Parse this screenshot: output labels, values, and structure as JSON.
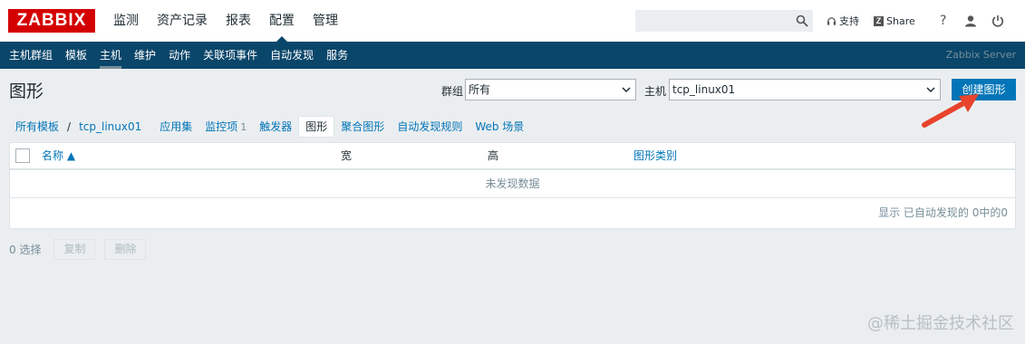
{
  "app": {
    "logo": "ZABBIX",
    "top_menu": [
      "监测",
      "资产记录",
      "报表",
      "配置",
      "管理"
    ],
    "support_label": "支持",
    "share_label": "Share",
    "help_label": "?"
  },
  "subnav": {
    "items": [
      "主机群组",
      "模板",
      "主机",
      "维护",
      "动作",
      "关联项事件",
      "自动发现",
      "服务"
    ],
    "server_name": "Zabbix Server"
  },
  "header": {
    "title": "图形",
    "group_label": "群组",
    "group_value": "所有",
    "host_label": "主机",
    "host_value": "tcp_linux01",
    "create_button": "创建图形"
  },
  "breadcrumb": {
    "all_templates": "所有模板",
    "separator": "/",
    "host": "tcp_linux01",
    "tabs": [
      {
        "label": "应用集",
        "count": ""
      },
      {
        "label": "监控项",
        "count": "1"
      },
      {
        "label": "触发器",
        "count": ""
      },
      {
        "label": "图形",
        "count": ""
      },
      {
        "label": "聚合图形",
        "count": ""
      },
      {
        "label": "自动发现规则",
        "count": ""
      },
      {
        "label": "Web 场景",
        "count": ""
      }
    ]
  },
  "table": {
    "columns": {
      "name": "名称 ▲",
      "width": "宽",
      "height": "高",
      "graph_type": "图形类别"
    },
    "empty_text": "未发现数据",
    "footer_text": "显示 已自动发现的 0中的0"
  },
  "actions": {
    "selected": "0 选择",
    "copy": "复制",
    "delete": "删除"
  },
  "watermark": "@稀土掘金技术社区",
  "colors": {
    "brand": "#d40000",
    "nav": "#0a466a",
    "link": "#0275b8",
    "arrow": "#e8442d"
  }
}
